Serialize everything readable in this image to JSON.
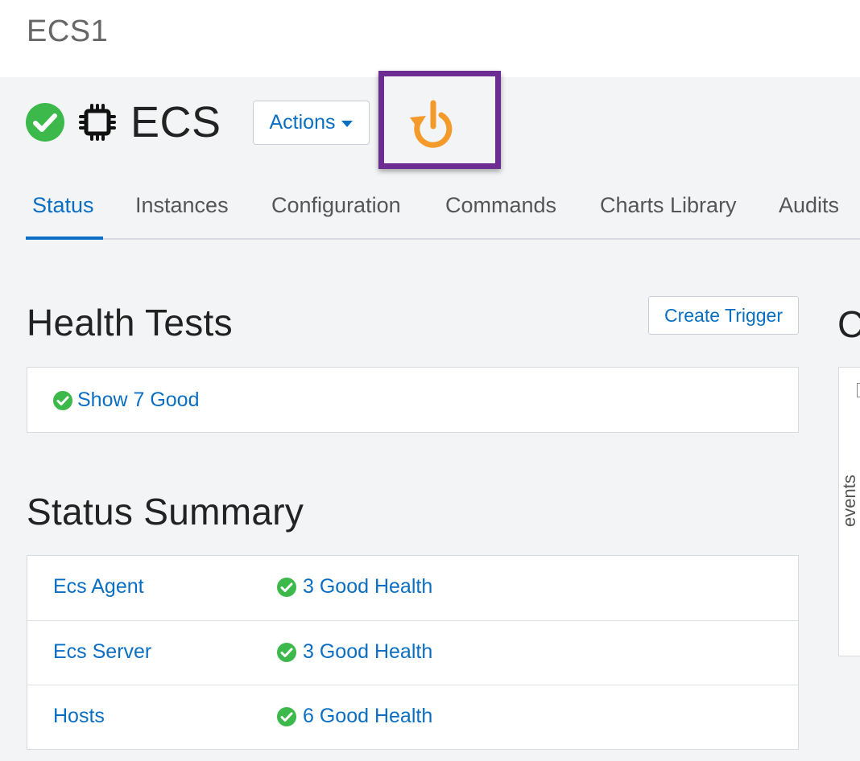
{
  "cluster": {
    "name": "ECS1"
  },
  "service": {
    "name": "ECS",
    "actions_label": "Actions"
  },
  "tabs": [
    {
      "label": "Status",
      "active": true
    },
    {
      "label": "Instances"
    },
    {
      "label": "Configuration"
    },
    {
      "label": "Commands"
    },
    {
      "label": "Charts Library"
    },
    {
      "label": "Audits"
    }
  ],
  "health_tests": {
    "title": "Health Tests",
    "create_trigger_label": "Create Trigger",
    "show_good_label": "Show 7 Good"
  },
  "status_summary": {
    "title": "Status Summary",
    "rows": [
      {
        "name": "Ecs Agent",
        "health": "3 Good Health"
      },
      {
        "name": "Ecs Server",
        "health": "3 Good Health"
      },
      {
        "name": "Hosts",
        "health": "6 Good Health"
      }
    ]
  },
  "side": {
    "heading_initial": "C",
    "axis_label": "events"
  },
  "colors": {
    "accent": "#0a6fc2",
    "good": "#3cb94a",
    "restart": "#f39a2b",
    "highlight": "#6d2c91"
  },
  "icons": [
    "health-good-icon",
    "chip-icon",
    "restart-icon",
    "caret-down-icon"
  ]
}
